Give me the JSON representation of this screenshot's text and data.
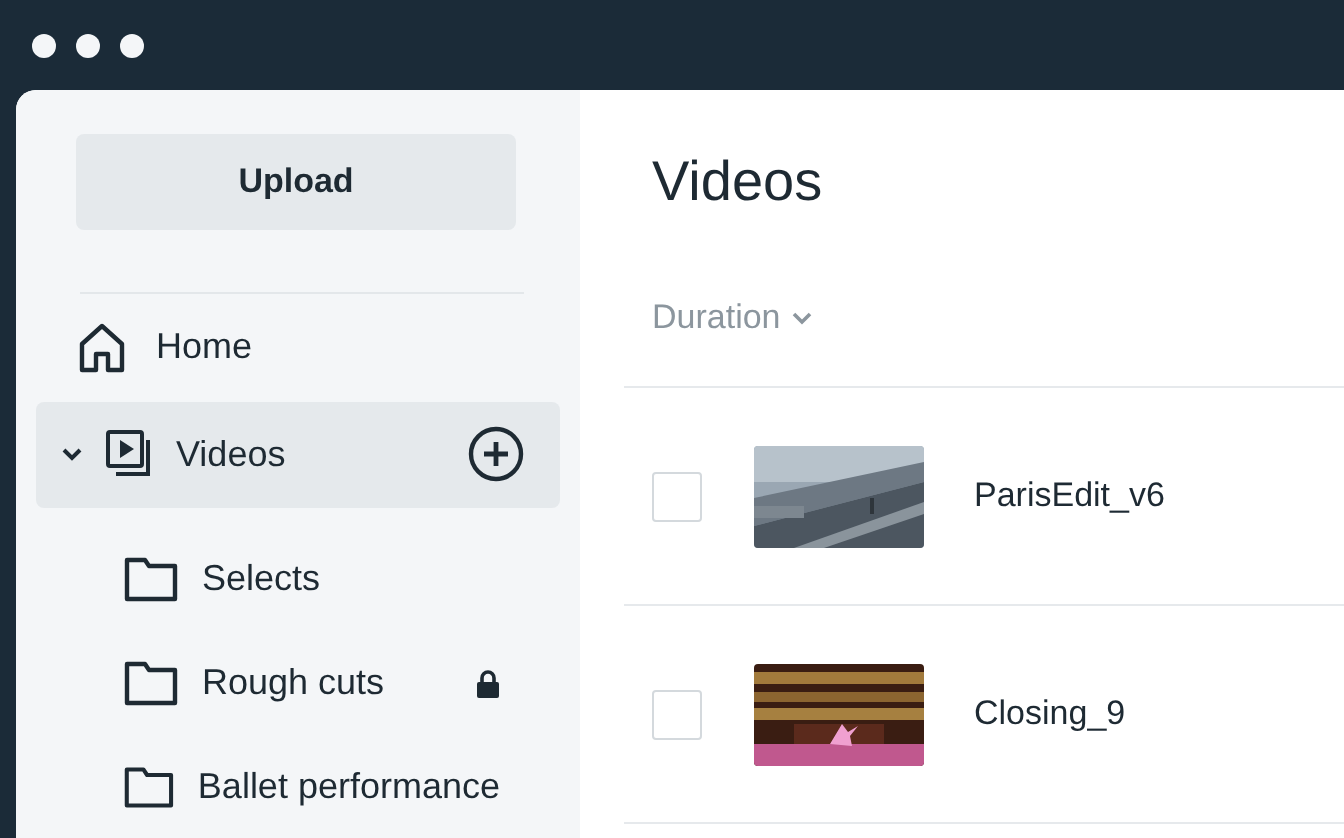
{
  "sidebar": {
    "upload_button": "Upload",
    "items": [
      {
        "kind": "home",
        "label": "Home",
        "selected": false
      },
      {
        "kind": "videos",
        "label": "Videos",
        "selected": true,
        "expanded": true,
        "children": [
          {
            "label": "Selects",
            "locked": false
          },
          {
            "label": "Rough cuts",
            "locked": true
          },
          {
            "label": "Ballet performance",
            "locked": false
          }
        ]
      }
    ]
  },
  "main": {
    "title": "Videos",
    "sort": {
      "label": "Duration"
    },
    "rows": [
      {
        "name": "ParisEdit_v6",
        "checked": false
      },
      {
        "name": "Closing_9",
        "checked": false
      }
    ]
  }
}
